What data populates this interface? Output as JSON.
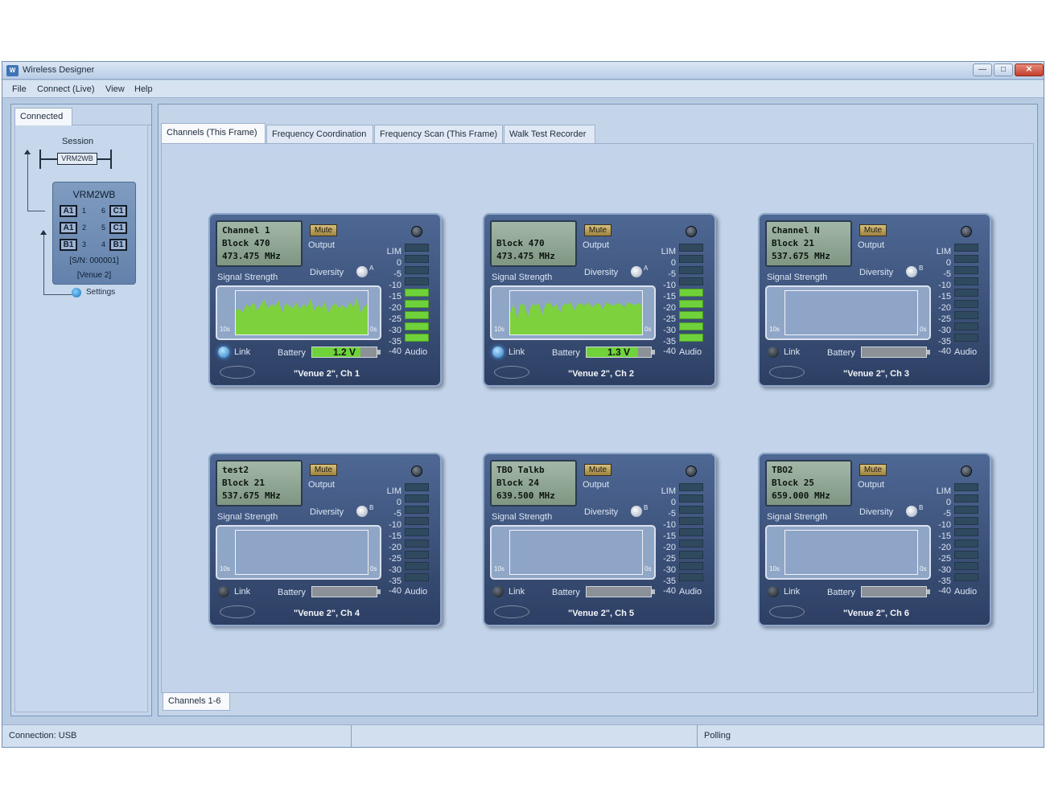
{
  "window": {
    "title": "Wireless Designer"
  },
  "menu": [
    "File",
    "Connect (Live)",
    "View",
    "Help"
  ],
  "left_panel": {
    "tab": "Connected",
    "session_label": "Session",
    "session_name": "VRM2WB",
    "device": {
      "name": "VRM2WB",
      "ports": [
        {
          "left": "A1",
          "lnum": "1",
          "rnum": "6",
          "right": "C1"
        },
        {
          "left": "A1",
          "lnum": "2",
          "rnum": "5",
          "right": "C1"
        },
        {
          "left": "B1",
          "lnum": "3",
          "rnum": "4",
          "right": "B1"
        }
      ],
      "serial": "[S/N: 000001]",
      "venue": "[Venue 2]"
    },
    "settings_label": "Settings"
  },
  "tabs": [
    "Channels (This Frame)",
    "Frequency Coordination",
    "Frequency Scan (This Frame)",
    "Walk Test Recorder"
  ],
  "bottom_tab": "Channels 1-6",
  "status": {
    "connection": "Connection: USB",
    "middle": "",
    "mode": "Polling"
  },
  "labels": {
    "mute": "Mute",
    "output": "Output",
    "diversity": "Diversity",
    "signal_strength": "Signal Strength",
    "link": "Link",
    "battery": "Battery",
    "audio": "Audio",
    "graph_left": "10s",
    "graph_right": "0s",
    "meter": [
      "LIM",
      "0",
      "-5",
      "-10",
      "-15",
      "-20",
      "-25",
      "-30",
      "-35",
      "-40"
    ]
  },
  "channels": [
    {
      "line1": "Channel 1",
      "line2": "Block 470",
      "line3": "473.475 MHz",
      "diversity": "A",
      "link_active": true,
      "battery_text": "1.2 V",
      "battery_fill": 0.75,
      "footer": "\"Venue 2\", Ch 1",
      "signal_present": true,
      "meter_on": 5
    },
    {
      "line1": "",
      "line2": "Block 470",
      "line3": "473.475 MHz",
      "diversity": "A",
      "link_active": true,
      "battery_text": "1.3 V",
      "battery_fill": 0.8,
      "footer": "\"Venue 2\", Ch 2",
      "signal_present": true,
      "meter_on": 5
    },
    {
      "line1": "Channel N",
      "line2": "Block 21",
      "line3": "537.675 MHz",
      "diversity": "B",
      "link_active": false,
      "battery_text": "",
      "battery_fill": 0,
      "footer": "\"Venue 2\", Ch 3",
      "signal_present": false,
      "meter_on": 0
    },
    {
      "line1": "test2",
      "line2": "Block 21",
      "line3": "537.675 MHz",
      "diversity": "B",
      "link_active": false,
      "battery_text": "",
      "battery_fill": 0,
      "footer": "\"Venue 2\", Ch 4",
      "signal_present": false,
      "meter_on": 0
    },
    {
      "line1": "TBO Talkb",
      "line2": "Block 24",
      "line3": "639.500 MHz",
      "diversity": "B",
      "link_active": false,
      "battery_text": "",
      "battery_fill": 0,
      "footer": "\"Venue 2\", Ch 5",
      "signal_present": false,
      "meter_on": 0
    },
    {
      "line1": "TBO2",
      "line2": "Block 25",
      "line3": "659.000 MHz",
      "diversity": "B",
      "link_active": false,
      "battery_text": "",
      "battery_fill": 0,
      "footer": "\"Venue 2\", Ch 6",
      "signal_present": false,
      "meter_on": 0
    }
  ]
}
